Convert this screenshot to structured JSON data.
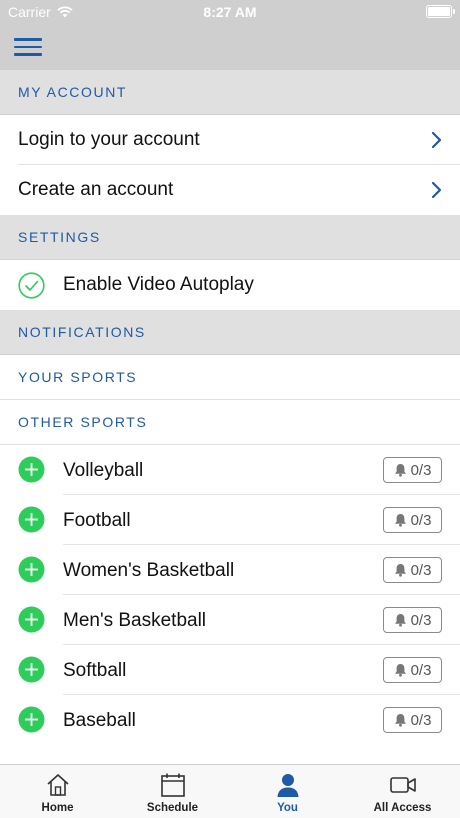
{
  "status_bar": {
    "carrier": "Carrier",
    "time": "8:27 AM"
  },
  "sections": {
    "my_account": "MY ACCOUNT",
    "settings": "SETTINGS",
    "notifications": "NOTIFICATIONS",
    "your_sports": "YOUR SPORTS",
    "other_sports": "OTHER SPORTS"
  },
  "account": {
    "login_label": "Login to your account",
    "create_label": "Create an account"
  },
  "settings": {
    "autoplay_label": "Enable Video Autoplay",
    "autoplay_enabled": true
  },
  "other_sports": [
    {
      "name": "Volleyball",
      "alerts": "0/3"
    },
    {
      "name": "Football",
      "alerts": "0/3"
    },
    {
      "name": "Women's Basketball",
      "alerts": "0/3"
    },
    {
      "name": "Men's Basketball",
      "alerts": "0/3"
    },
    {
      "name": "Softball",
      "alerts": "0/3"
    },
    {
      "name": "Baseball",
      "alerts": "0/3"
    }
  ],
  "tabs": [
    {
      "label": "Home",
      "icon": "home-icon"
    },
    {
      "label": "Schedule",
      "icon": "calendar-icon"
    },
    {
      "label": "You",
      "icon": "person-icon",
      "active": true
    },
    {
      "label": "All Access",
      "icon": "video-camera-icon"
    }
  ],
  "colors": {
    "accent": "#1e5aa8",
    "add_green": "#2ecc5a",
    "header_gray": "#e0e0e0"
  }
}
